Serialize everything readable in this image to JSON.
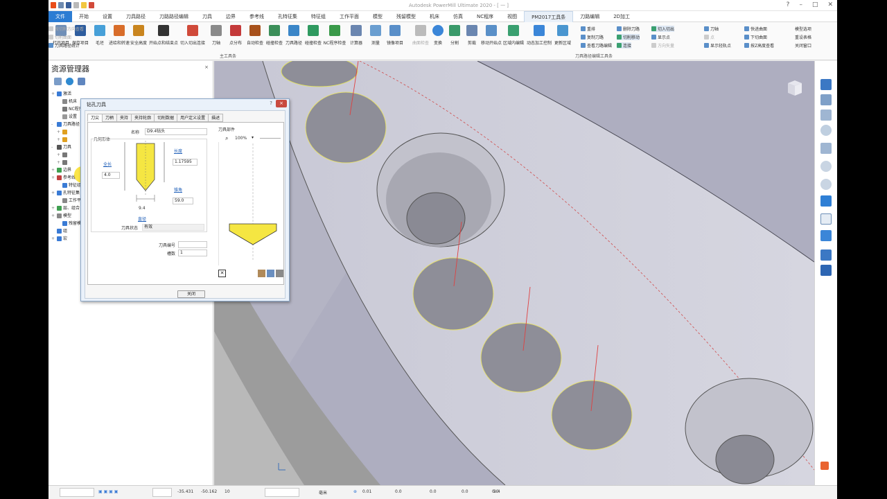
{
  "app": {
    "title": "Autodesk PowerMill Ultimate 2020 - [ 一 ]"
  },
  "menu": {
    "tabs": [
      "文件",
      "开始",
      "设置",
      "刀具路径",
      "刀路路径编辑",
      "刀具",
      "边界",
      "参考线",
      "孔特征集",
      "特征组",
      "工作平面",
      "模型",
      "残留模型",
      "机床",
      "仿真",
      "NC程序",
      "视图",
      "PM2017工具条",
      "刀路编辑",
      "2D加工"
    ],
    "active": "PM2017工具条"
  },
  "ribbon": {
    "main_buttons": [
      "打开项目",
      "保存项目",
      "毛坯",
      "进给和转速",
      "安全高度",
      "开始点和结束点",
      "切入切出连接",
      "刀轴",
      "点分布",
      "自动检查",
      "碰撞检查",
      "刀具路径",
      "碰撞检查",
      "NC程序检查",
      "计算器",
      "测量",
      "镜像项目"
    ],
    "main_caption": "主工具条",
    "edit_buttons": [
      "曲面检查",
      "变换",
      "分割",
      "剪裁",
      "移动开始点",
      "区域内编辑",
      "动态加工控制",
      "更新区域"
    ],
    "edit_small": [
      {
        "label": "重排",
        "state": "normal"
      },
      {
        "label": "复制刀路",
        "state": "normal"
      },
      {
        "label": "查看刀路编辑",
        "state": "normal"
      },
      {
        "label": "删除刀路",
        "state": "normal"
      },
      {
        "label": "切削移动",
        "state": "highlight"
      },
      {
        "label": "连接",
        "state": "highlight"
      },
      {
        "label": "切入切出",
        "state": "highlight"
      },
      {
        "label": "显示点",
        "state": "normal"
      },
      {
        "label": "方向矢量",
        "state": "dim"
      },
      {
        "label": "刀轴",
        "state": "normal"
      },
      {
        "label": "点",
        "state": "dim"
      },
      {
        "label": "显示轻轨点",
        "state": "normal"
      },
      {
        "label": "快进曲面",
        "state": "normal"
      },
      {
        "label": "下切曲面",
        "state": "normal"
      },
      {
        "label": "按Z高度查看",
        "state": "normal"
      },
      {
        "label": "按切削方向查看",
        "state": "dim"
      },
      {
        "label": "切削曲面",
        "state": "dim"
      },
      {
        "label": "刀具路径统计",
        "state": "normal"
      }
    ],
    "edit_caption": "刀具路径编辑工具条",
    "right_items": [
      "模型选项",
      "重设表格",
      "关闭窗口"
    ]
  },
  "explorer": {
    "title": "资源管理器",
    "close": "×",
    "tree": [
      {
        "label": "激活",
        "expand": "+",
        "color": "#3a7bd5"
      },
      {
        "label": "机床",
        "expand": "",
        "color": "#888888"
      },
      {
        "label": "NC程序",
        "expand": "",
        "color": "#777777"
      },
      {
        "label": "设置",
        "expand": "",
        "color": "#999999"
      },
      {
        "label": "刀具路径",
        "expand": "-",
        "color": "#3a7bd5"
      },
      {
        "label": "",
        "expand": "+",
        "color": "#e0a020"
      },
      {
        "label": "",
        "expand": "+",
        "color": "#e0a020"
      },
      {
        "label": "刀具",
        "expand": "-",
        "color": "#555555"
      },
      {
        "label": "",
        "expand": "+",
        "color": "#777777"
      },
      {
        "label": "",
        "expand": "+",
        "color": "#777777"
      },
      {
        "label": "边界",
        "expand": "+",
        "color": "#3fa050"
      },
      {
        "label": "参考线",
        "expand": "+",
        "color": "#c04040"
      },
      {
        "label": "特征组",
        "expand": "",
        "color": "#3a7bd5"
      },
      {
        "label": "孔特征集",
        "expand": "+",
        "color": "#3a7bd5"
      },
      {
        "label": "工作平面",
        "expand": "",
        "color": "#888888"
      },
      {
        "label": "层、组合",
        "expand": "+",
        "color": "#3fa050"
      },
      {
        "label": "模型",
        "expand": "+",
        "color": "#888888"
      },
      {
        "label": "残留模型",
        "expand": "",
        "color": "#3a7bd5"
      },
      {
        "label": "组",
        "expand": "",
        "color": "#3a7bd5"
      },
      {
        "label": "宏",
        "expand": "+",
        "color": "#3a7bd5"
      }
    ]
  },
  "dialog": {
    "title": "钻孔刀具",
    "help": "?",
    "close": "×",
    "tabs": [
      "刀尖",
      "刀柄",
      "夹持",
      "夹持轮廓",
      "切削数据",
      "用户定义设置",
      "描述"
    ],
    "active_tab": "刀尖",
    "name_label": "名称",
    "name_value": "D9.4钻头",
    "geometry_label": "几何形体",
    "length_link": "长度",
    "length_value": "1.17595",
    "overall_link": "全长",
    "overall_value": "4.0",
    "angle_link": "锥角",
    "angle_value": "59.0",
    "diameter_value": "9.4",
    "diameter_link": "直径",
    "status_label": "刀具状态",
    "status_value": "有效",
    "parts_label": "刀具部件",
    "zoom_value": "100%",
    "number_label": "刀具编号",
    "number_value": "",
    "flutes_label": "槽数",
    "flutes_value": "1",
    "close_button": "关闭"
  },
  "statusbar": {
    "x": "-35.431",
    "y": "-50.162",
    "z": "10",
    "unit": "毫米",
    "tolerance": "0.01",
    "thickness": "0.0",
    "axial": "0.0",
    "radial": "0.0",
    "offset": "0.0",
    "diameter": "9.4"
  },
  "colors": {
    "accent": "#2b7cd3",
    "viewport_bg": "#b6b6c6",
    "tool_yellow": "#f5e642",
    "toolpath_red": "#e04040"
  }
}
